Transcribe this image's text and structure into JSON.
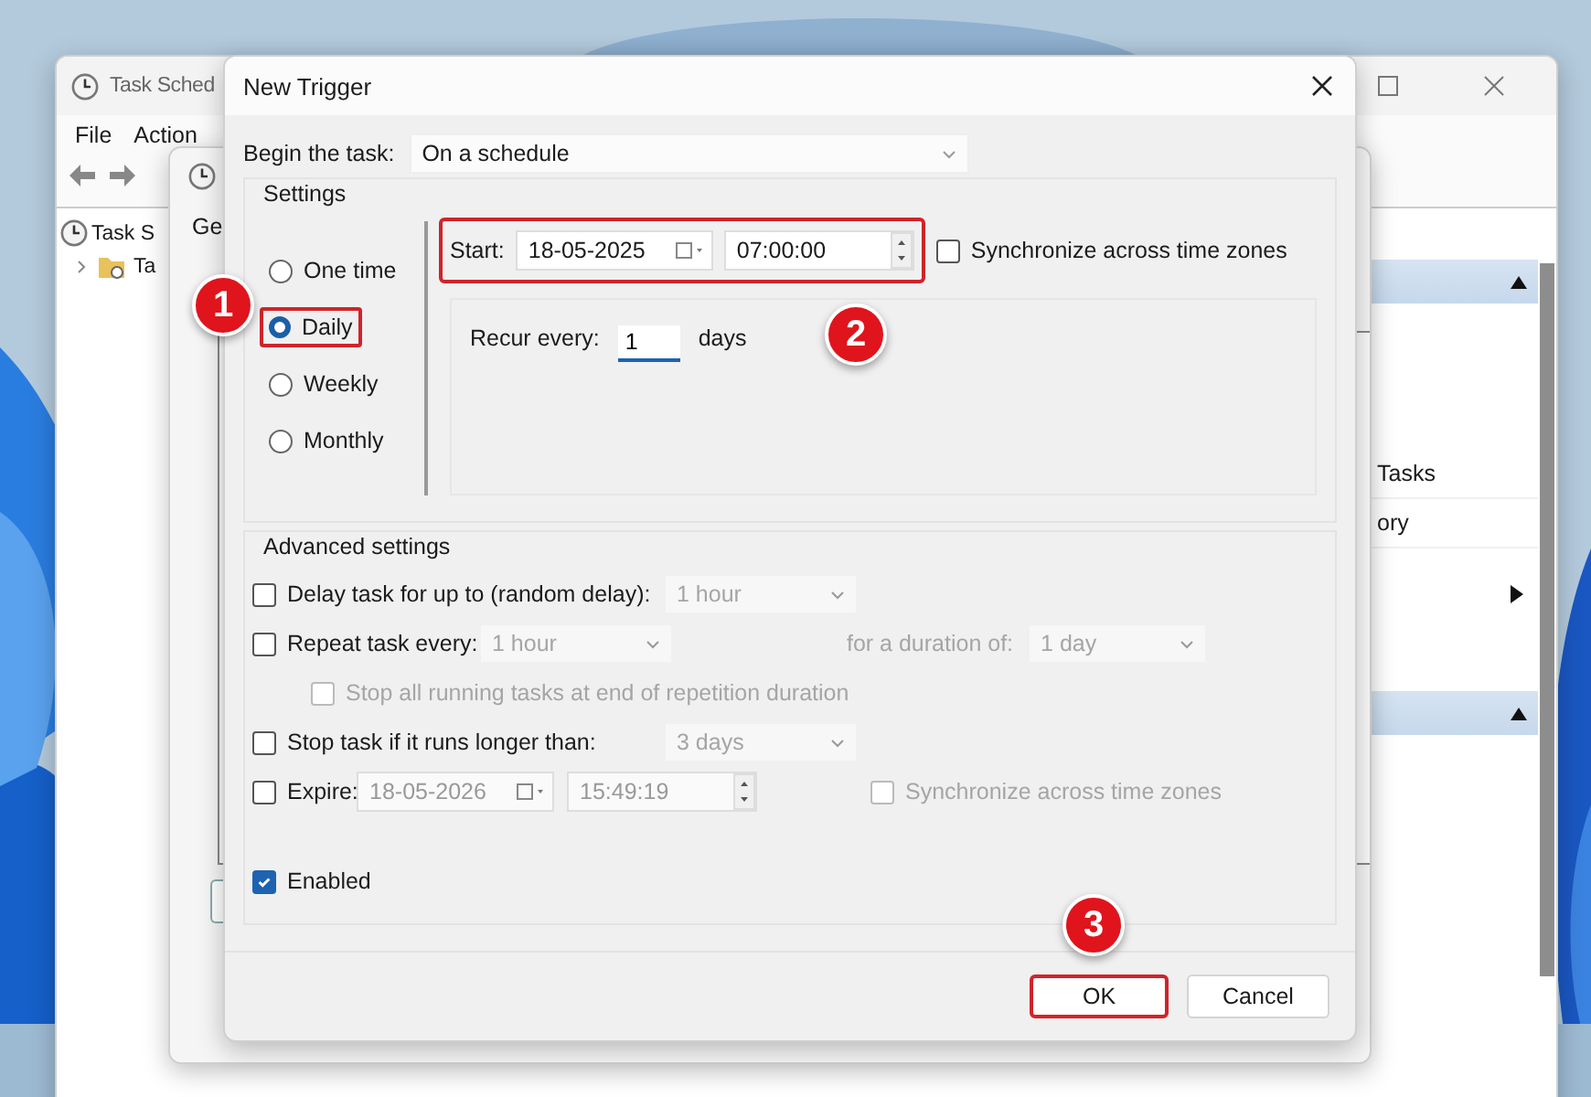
{
  "background_window": {
    "title": "Task Sched",
    "menu": [
      "File",
      "Action"
    ],
    "tree": [
      {
        "label": "Task S",
        "children": [
          {
            "label": "Ta",
            "expanded": false
          }
        ]
      }
    ],
    "actions_panel": [
      {
        "kind": "header"
      },
      {
        "kind": "item",
        "label": "Tasks"
      },
      {
        "kind": "item",
        "label": "ory"
      },
      {
        "kind": "submenu"
      },
      {
        "kind": "header"
      }
    ]
  },
  "properties_window": {
    "tab": "Ge"
  },
  "dialog": {
    "title": "New Trigger",
    "begin_label": "Begin the task:",
    "begin_value": "On a schedule",
    "settings_label": "Settings",
    "schedule_options": [
      {
        "label": "One time",
        "selected": false,
        "highlighted": false
      },
      {
        "label": "Daily",
        "selected": true,
        "highlighted": true
      },
      {
        "label": "Weekly",
        "selected": false,
        "highlighted": false
      },
      {
        "label": "Monthly",
        "selected": false,
        "highlighted": false
      }
    ],
    "start": {
      "label": "Start:",
      "date": "18-05-2025",
      "time": "07:00:00",
      "highlighted": true
    },
    "sync": {
      "label": "Synchronize across time zones",
      "checked": false
    },
    "recur": {
      "label": "Recur every:",
      "value": "1",
      "unit": "days"
    },
    "advanced_label": "Advanced settings",
    "advanced": [
      {
        "kind": "combo",
        "label": "Delay task for up to (random delay):",
        "checked": false,
        "value": "1 hour"
      },
      {
        "kind": "repeat",
        "label": "Repeat task every:",
        "checked": false,
        "value": "1 hour",
        "duration_label": "for a duration of:",
        "duration_value": "1 day"
      },
      {
        "kind": "sub",
        "label": "Stop all running tasks at end of repetition duration",
        "checked": false,
        "disabled": true
      },
      {
        "kind": "combo",
        "label": "Stop task if it runs longer than:",
        "checked": false,
        "value": "3 days"
      },
      {
        "kind": "expire",
        "label": "Expire:",
        "checked": false,
        "date": "18-05-2026",
        "time": "15:49:19",
        "sync_label": "Synchronize across time zones",
        "sync_checked": false
      }
    ],
    "enabled": {
      "label": "Enabled",
      "checked": true
    },
    "buttons": [
      {
        "label": "OK",
        "highlighted": true
      },
      {
        "label": "Cancel",
        "highlighted": false
      }
    ]
  },
  "callouts": [
    {
      "label": "1"
    },
    {
      "label": "2"
    },
    {
      "label": "3"
    }
  ]
}
